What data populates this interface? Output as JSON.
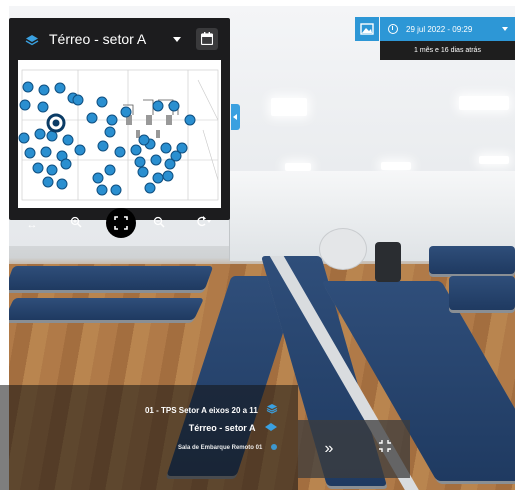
{
  "floorplan": {
    "title": "Térreo - setor A",
    "icons": {
      "layer": "layers-icon",
      "dropdown": "chevron-down-icon",
      "calendar": "calendar-icon"
    },
    "toolbar": [
      "arrows-horizontal-icon",
      "zoom-in-icon",
      "fullscreen-icon",
      "zoom-out-icon",
      "rotate-icon"
    ]
  },
  "capture": {
    "datetime": "29 jul 2022 - 09:29",
    "elapsed": "1 mês e 16 dias atrás",
    "icons": {
      "image": "image-icon",
      "clock": "clock-icon"
    }
  },
  "location": {
    "line1": "01 - TPS Setor A eixos 20 a 11",
    "line2": "Térreo - setor A",
    "line3": "Sala de Embarque Remoto 01"
  },
  "colors": {
    "accent": "#2d97d6",
    "panel": "#1c1c1e",
    "marker": "#2a8fd0"
  }
}
